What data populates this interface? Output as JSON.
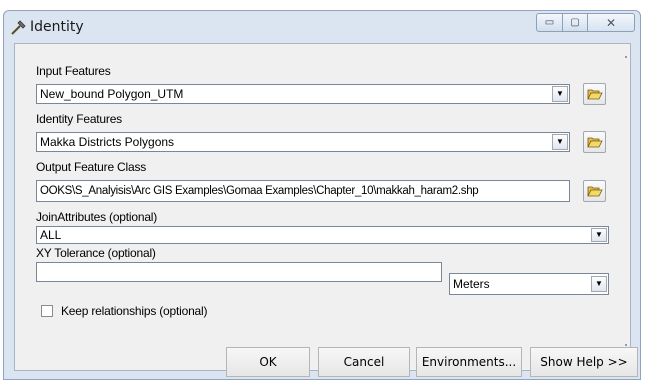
{
  "window": {
    "title": "Identity",
    "minimize_glyph": "▭",
    "maximize_glyph": "▢",
    "close_glyph": "✕"
  },
  "fields": {
    "input_features": {
      "label": "Input Features",
      "value": "New_bound Polygon_UTM"
    },
    "identity_features": {
      "label": "Identity Features",
      "value": "Makka Districts Polygons"
    },
    "output_feature_class": {
      "label": "Output Feature Class",
      "value": "OOKS\\S_Analyisis\\Arc GIS Examples\\Gomaa Examples\\Chapter_10\\makkah_haram2.shp"
    },
    "join_attributes": {
      "label": "JoinAttributes (optional)",
      "value": "ALL"
    },
    "xy_tolerance": {
      "label": "XY Tolerance (optional)",
      "value": "",
      "unit": "Meters"
    },
    "keep_relationships": {
      "label": "Keep relationships (optional)",
      "checked": false
    }
  },
  "buttons": {
    "ok": "OK",
    "cancel": "Cancel",
    "environments": "Environments...",
    "show_help": "Show Help >>"
  },
  "icons": {
    "title": "hammer-icon",
    "browse": "open-folder-icon",
    "dropdown": "chevron-down-icon"
  }
}
